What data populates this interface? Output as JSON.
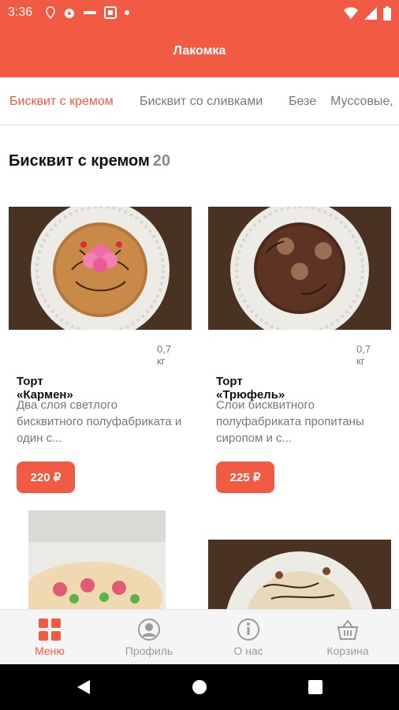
{
  "status": {
    "time": "3:36"
  },
  "app": {
    "title": "Лакомка"
  },
  "tabs": [
    {
      "label": "Бисквит с кремом"
    },
    {
      "label": "Бисквит со сливками"
    },
    {
      "label": "Безе"
    },
    {
      "label": "Муссовые,"
    }
  ],
  "section": {
    "title": "Бисквит с кремом",
    "count": "20"
  },
  "products": [
    {
      "weight": "0,7 кг",
      "name": "Торт «Кармен»",
      "desc": "Два слоя светлого бисквитного полуфабриката и один с...",
      "price": "220 ₽"
    },
    {
      "weight": "0,7 кг",
      "name": "Торт «Трюфель»",
      "desc": "Слои бисквитного полуфабриката пропитаны сиропом и с...",
      "price": "225 ₽"
    }
  ],
  "bottom_nav": [
    {
      "label": "Меню",
      "icon": "grid-icon"
    },
    {
      "label": "Профиль",
      "icon": "profile-icon"
    },
    {
      "label": "О нас",
      "icon": "info-icon"
    },
    {
      "label": "Корзина",
      "icon": "basket-icon"
    }
  ],
  "colors": {
    "accent": "#f15a43"
  }
}
